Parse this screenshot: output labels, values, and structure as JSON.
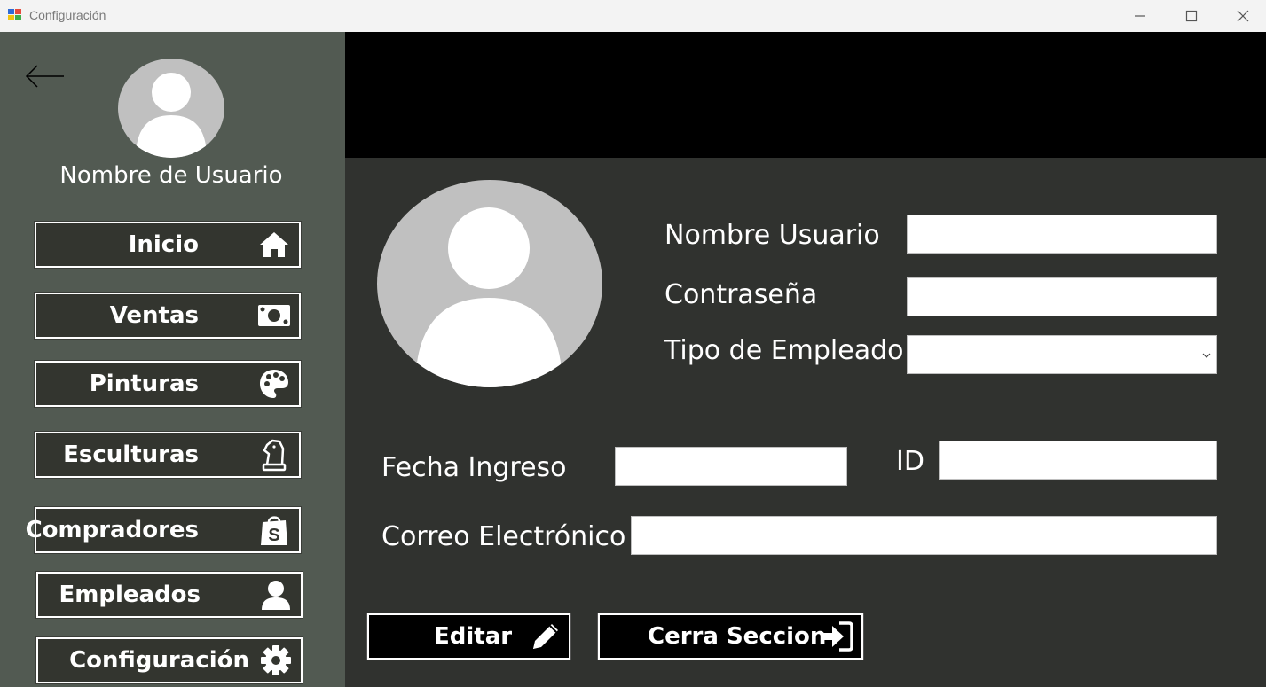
{
  "window": {
    "title": "Configuración",
    "controls": {
      "minimize": "minimize-icon",
      "maximize": "maximize-icon",
      "close": "close-icon"
    }
  },
  "sidebar": {
    "back_icon": "arrow-left-icon",
    "avatar_icon": "user-avatar-icon",
    "user_name": "Nombre de Usuario",
    "items": [
      {
        "label": "Inicio",
        "icon": "home-icon"
      },
      {
        "label": "Ventas",
        "icon": "money-icon"
      },
      {
        "label": "Pinturas",
        "icon": "palette-icon"
      },
      {
        "label": "Esculturas",
        "icon": "chess-knight-icon"
      },
      {
        "label": "Compradores",
        "icon": "shopping-bag-icon"
      },
      {
        "label": "Empleados",
        "icon": "user-icon"
      },
      {
        "label": "Configuración",
        "icon": "gear-icon"
      }
    ]
  },
  "form": {
    "profile_avatar_icon": "user-avatar-icon",
    "nombre_usuario_label": "Nombre Usuario",
    "nombre_usuario_value": "",
    "contrasena_label": "Contraseña",
    "contrasena_value": "",
    "tipo_empleado_label": "Tipo de Empleado",
    "tipo_empleado_value": "",
    "fecha_ingreso_label": "Fecha Ingreso",
    "fecha_ingreso_value": "",
    "id_label": "ID",
    "id_value": "",
    "correo_label": "Correo Electrónico",
    "correo_value": ""
  },
  "actions": {
    "edit_label": "Editar",
    "edit_icon": "pencil-icon",
    "logout_label": "Cerra Seccion",
    "logout_icon": "sign-in-icon"
  },
  "colors": {
    "sidebar_bg": "#525a52",
    "main_bg": "#30322f",
    "top_band": "#000000",
    "nav_button_bg": "#33352f",
    "action_button_bg": "#000000",
    "avatar_gray": "#c0c0c0"
  }
}
